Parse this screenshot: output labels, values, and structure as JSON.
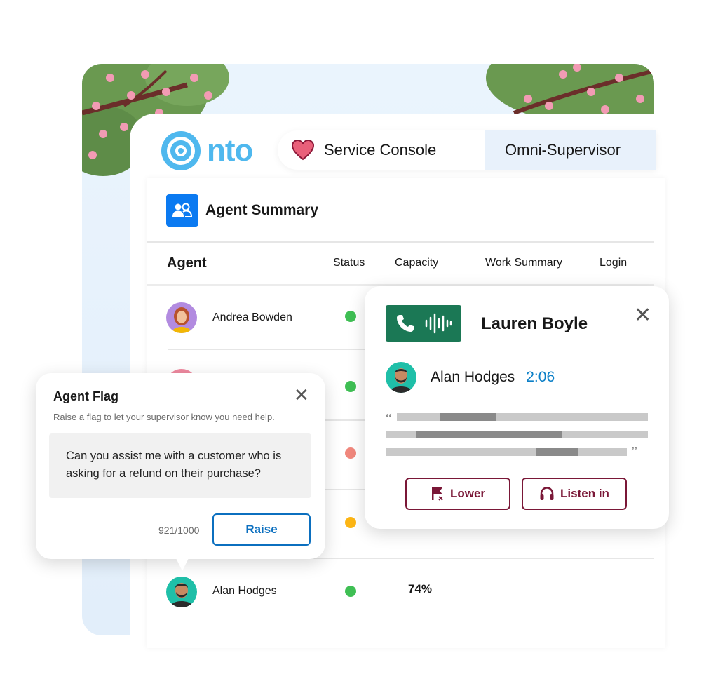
{
  "brand": {
    "logo_text": "nto"
  },
  "tabs": {
    "console_label": "Service Console",
    "supervisor_label": "Omni-Supervisor"
  },
  "summary": {
    "title": "Agent Summary",
    "columns": {
      "agent": "Agent",
      "status": "Status",
      "capacity": "Capacity",
      "work_summary": "Work Summary",
      "login": "Login"
    },
    "rows": [
      {
        "name": "Andrea Bowden",
        "status_color": "#3fbf54"
      },
      {
        "name": "",
        "status_color": "#3fbf54"
      },
      {
        "name": "",
        "status_color": "#f0877c"
      },
      {
        "name": "",
        "status_color": "#fcb514"
      },
      {
        "name": "Alan Hodges",
        "status_color": "#3fbf54",
        "capacity": "74%"
      }
    ]
  },
  "call": {
    "name": "Lauren Boyle",
    "caller_name": "Alan Hodges",
    "duration": "2:06",
    "quote_open": "“",
    "quote_close": "”",
    "lower_label": "Lower",
    "listen_label": "Listen in",
    "close_icon": "✕",
    "accent": "#1b7855"
  },
  "flag": {
    "title": "Agent Flag",
    "subtitle": "Raise a flag to let your supervisor know you need help.",
    "message": "Can you assist me with a customer who is asking for a refund on their purchase?",
    "counter": "921/1000",
    "raise_label": "Raise",
    "close_icon": "✕"
  },
  "colors": {
    "brand_blue": "#4fb8ee",
    "accent_maroon": "#7a1737",
    "link_blue": "#0b6fbf"
  }
}
